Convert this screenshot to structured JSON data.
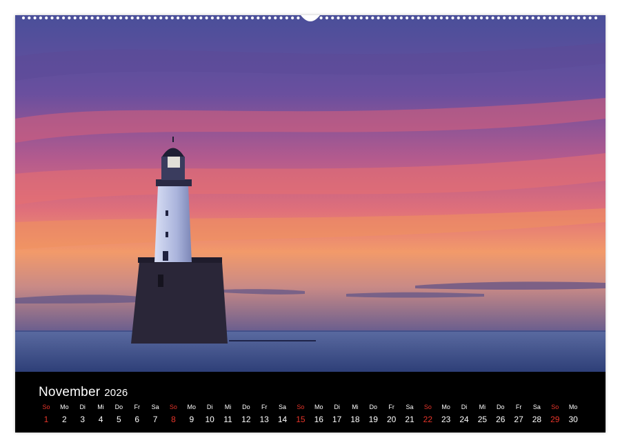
{
  "calendar": {
    "month": "November",
    "year": "2026",
    "colors": {
      "sunday": "#e8352a",
      "text": "#ffffff",
      "band": "#000000"
    },
    "days": [
      {
        "wd": "So",
        "n": "1",
        "sun": true
      },
      {
        "wd": "Mo",
        "n": "2",
        "sun": false
      },
      {
        "wd": "Di",
        "n": "3",
        "sun": false
      },
      {
        "wd": "Mi",
        "n": "4",
        "sun": false
      },
      {
        "wd": "Do",
        "n": "5",
        "sun": false
      },
      {
        "wd": "Fr",
        "n": "6",
        "sun": false
      },
      {
        "wd": "Sa",
        "n": "7",
        "sun": false
      },
      {
        "wd": "So",
        "n": "8",
        "sun": true
      },
      {
        "wd": "Mo",
        "n": "9",
        "sun": false
      },
      {
        "wd": "Di",
        "n": "10",
        "sun": false
      },
      {
        "wd": "Mi",
        "n": "11",
        "sun": false
      },
      {
        "wd": "Do",
        "n": "12",
        "sun": false
      },
      {
        "wd": "Fr",
        "n": "13",
        "sun": false
      },
      {
        "wd": "Sa",
        "n": "14",
        "sun": false
      },
      {
        "wd": "So",
        "n": "15",
        "sun": true
      },
      {
        "wd": "Mo",
        "n": "16",
        "sun": false
      },
      {
        "wd": "Di",
        "n": "17",
        "sun": false
      },
      {
        "wd": "Mi",
        "n": "18",
        "sun": false
      },
      {
        "wd": "Do",
        "n": "19",
        "sun": false
      },
      {
        "wd": "Fr",
        "n": "20",
        "sun": false
      },
      {
        "wd": "Sa",
        "n": "21",
        "sun": false
      },
      {
        "wd": "So",
        "n": "22",
        "sun": true
      },
      {
        "wd": "Mo",
        "n": "23",
        "sun": false
      },
      {
        "wd": "Di",
        "n": "24",
        "sun": false
      },
      {
        "wd": "Mi",
        "n": "25",
        "sun": false
      },
      {
        "wd": "Do",
        "n": "26",
        "sun": false
      },
      {
        "wd": "Fr",
        "n": "27",
        "sun": false
      },
      {
        "wd": "Sa",
        "n": "28",
        "sun": false
      },
      {
        "wd": "So",
        "n": "29",
        "sun": true
      },
      {
        "wd": "Mo",
        "n": "30",
        "sun": false
      }
    ]
  }
}
